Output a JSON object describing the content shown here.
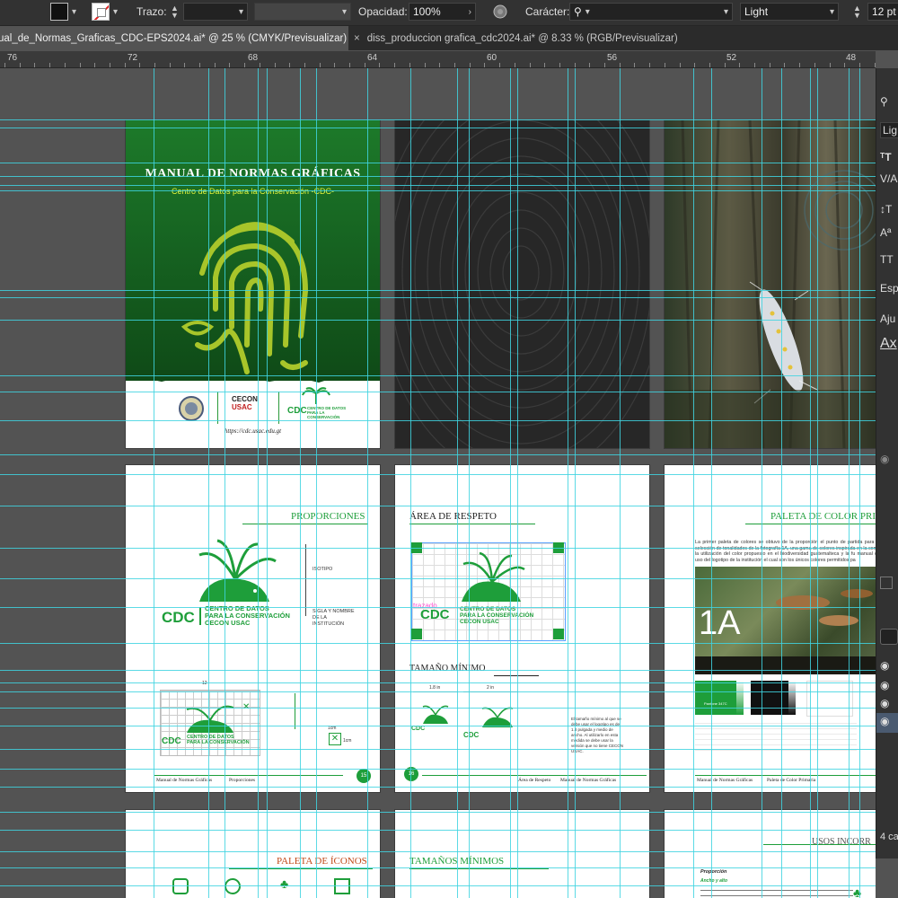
{
  "control_bar": {
    "stroke_label": "Trazo:",
    "opacity_label": "Opacidad:",
    "opacity_value": "100%",
    "character_label": "Carácter:",
    "font_style": "Light",
    "font_size": "12 pt"
  },
  "tabs": [
    {
      "label": "ual_de_Normas_Graficas_CDC-EPS2024.ai* @ 25 % (CMYK/Previsualizar)",
      "close": "×"
    },
    {
      "label": "diss_produccion grafica_cdc2024.ai* @ 8.33 % (RGB/Previsualizar)",
      "close": "×"
    }
  ],
  "ruler": {
    "labels": [
      "76",
      "72",
      "68",
      "64",
      "60",
      "56",
      "52",
      "48"
    ]
  },
  "cover": {
    "title": "MANUAL DE NORMAS GRÁFICAS",
    "subtitle": "Centro de Datos para la Conservación -CDC-",
    "url": "https://cdc.usac.edu.gt",
    "logo_text": "CDC",
    "logo_small": "CENTRO DE DATOS PARA LA CONSERVACIÓN",
    "cecon_text": "CECON",
    "usac_text": "USAC"
  },
  "proporciones": {
    "heading": "PROPORCIONES",
    "isotipo": "ISOTIPO",
    "sigla": "SIGLA Y NOMBRE DE LA INSTITUCIÓN",
    "cdc": "CDC",
    "name_line1": "CENTRO DE DATOS",
    "name_line2": "PARA LA CONSERVACIÓN",
    "name_line3": "CECON USAC",
    "dim_top": "12",
    "dim_a": "1cm",
    "dim_b": "1cm",
    "footer_left": "Manual de Normas Gráficas",
    "footer_right": "Proporciones",
    "page_num": "15"
  },
  "respeto": {
    "heading": "ÁREA DE RESPETO",
    "trazado": "trazado",
    "min_heading": "TAMAÑO MÍNIMO",
    "size1": "1.8 in",
    "size2": "2 in",
    "desc": "El tamaño mínimo al que se debe usar el logotipo es de 1.8 pulgada y medio de ancho. Al utilizarlo en esta medida se debe usar la versión que no tiene CECON USAC.",
    "footer_left": "Área de Respeto",
    "footer_right": "Manual de Normas Gráficas",
    "page_num": "16"
  },
  "paleta": {
    "heading": "PALETA DE COLOR PRI",
    "body": "La primer paleta de colores se obtuvo de la proporción el punto de partida para la selección de tonalidades de la fotografía 1A, una gama de colores inspirada en la como la utilización del color propuesto en el biodiversidad guatemalteca y la fu manual de uso del logotipo de la institución el cual son los únicos colores permitidos pa",
    "photo_label": "1A",
    "swatch_title": "Pantone 347C",
    "footer_left": "Manual de Normas Gráficas",
    "footer_right": "Paleta de Color Primaria"
  },
  "bottom_row": {
    "iconos": "PALETA DE ÍCONOS",
    "tamanos": "TAMAÑOS MÍNIMOS",
    "usos": "USOS INCORR",
    "proporcion": "Proporción",
    "ancho_alto": "Ancho y alto"
  },
  "right_panel": {
    "items": [
      "Lig",
      "Esp",
      "Aju",
      "Ax",
      "4 ca"
    ]
  },
  "colors": {
    "guide": "#3fd3e0",
    "brand_green": "#1e9e3a",
    "cover_green": "#1b6e25",
    "lime": "#a8c52a"
  }
}
